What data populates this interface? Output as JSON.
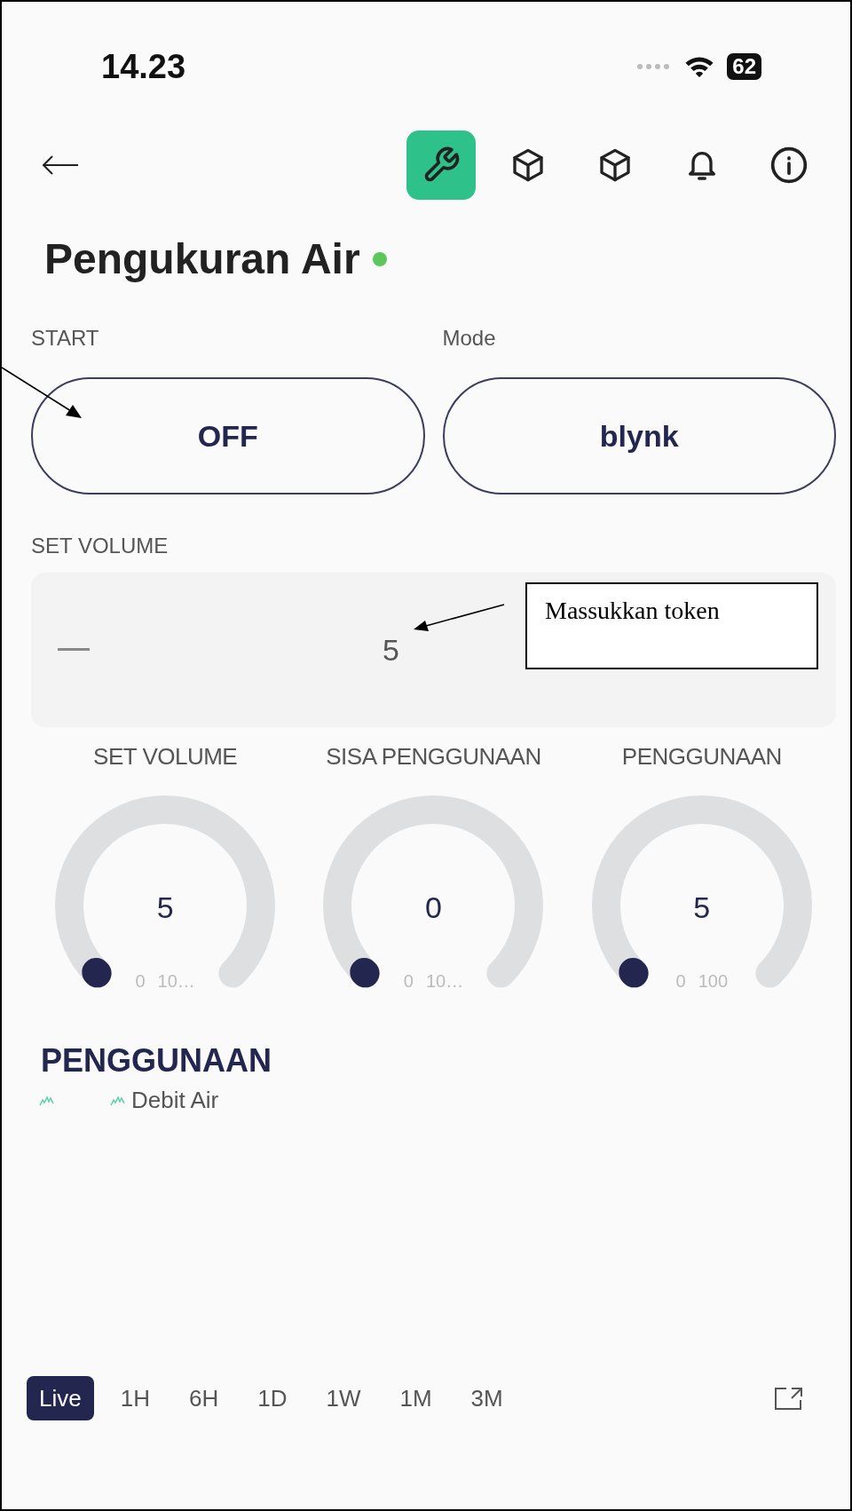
{
  "status_bar": {
    "time": "14.23",
    "battery": "62"
  },
  "toolbar": {
    "tools": [
      {
        "kind": "wrench",
        "selected": true
      },
      {
        "kind": "cube",
        "selected": false
      },
      {
        "kind": "cube",
        "selected": false
      },
      {
        "kind": "bell",
        "selected": false
      },
      {
        "kind": "info",
        "selected": false
      }
    ]
  },
  "title": "Pengukuran Air",
  "online": true,
  "controls": [
    {
      "label": "START",
      "value": "OFF"
    },
    {
      "label": "Mode",
      "value": "blynk"
    }
  ],
  "stepper": {
    "label": "SET VOLUME",
    "value": "5"
  },
  "gauges": [
    {
      "label": "SET VOLUME",
      "value": "5",
      "min": "0",
      "max": "10…"
    },
    {
      "label": "SISA PENGGUNAAN",
      "value": "0",
      "min": "0",
      "max": "10…"
    },
    {
      "label": "PENGGUNAAN",
      "value": "5",
      "min": "0",
      "max": "100"
    }
  ],
  "chart": {
    "title": "PENGGUNAAN",
    "legend": [
      {
        "kind": "icon"
      },
      {
        "kind": "series",
        "label": "Debit Air"
      }
    ]
  },
  "time_ranges": [
    {
      "label": "Live",
      "selected": true
    },
    {
      "label": "1H",
      "selected": false
    },
    {
      "label": "6H",
      "selected": false
    },
    {
      "label": "1D",
      "selected": false
    },
    {
      "label": "1W",
      "selected": false
    },
    {
      "label": "1M",
      "selected": false
    },
    {
      "label": "3M",
      "selected": false
    }
  ],
  "callout": {
    "text": "Massukkan token"
  }
}
